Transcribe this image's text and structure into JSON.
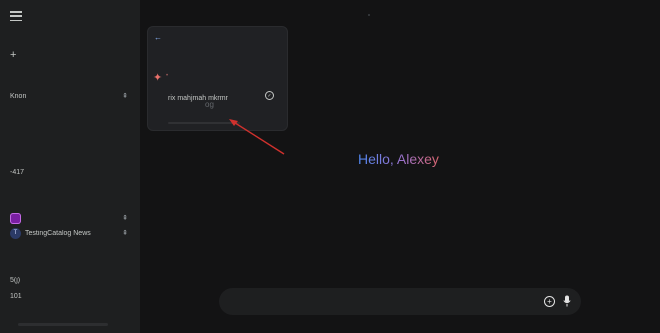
{
  "sidebar": {
    "menu_icon": "hamburger-menu-icon",
    "new_chat": {
      "icon": "plus-icon",
      "label": ""
    },
    "recent": [
      {
        "label": "Knon",
        "pin": "⇞"
      },
      {
        "label": "",
        "pin": ""
      },
      {
        "label": "",
        "pin": ""
      },
      {
        "label": "-417",
        "pin": ""
      }
    ],
    "gems": [
      {
        "label": "",
        "pin": "⇞"
      },
      {
        "label": "TestingCatalog News",
        "avatar": "T",
        "pin": "⇞"
      }
    ],
    "footer": [
      {
        "label": "5(j)"
      },
      {
        "label": "101"
      }
    ]
  },
  "panel": {
    "back_icon": "arrow-left-icon",
    "spark_icon": "sparkle-icon",
    "item_label": "rix mahjmah mkrmr",
    "overlay_label": "og",
    "check_icon": "check-circle-icon"
  },
  "greeting": "Hello, Alexey",
  "input": {
    "placeholder": "",
    "add_icon": "add-circle-icon",
    "mic_icon": "microphone-icon"
  },
  "colors": {
    "background": "#131314",
    "sidebar": "#1e1f20",
    "gradient_start": "#4f86f0",
    "gradient_end": "#d96570",
    "annotation_arrow": "#d0312d"
  }
}
